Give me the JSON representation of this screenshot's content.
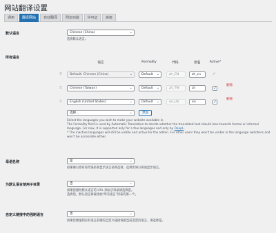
{
  "page": {
    "title": "网站翻译设置"
  },
  "tabs": [
    {
      "label": "通用",
      "active": false
    },
    {
      "label": "翻译网站",
      "active": true
    },
    {
      "label": "自动翻译",
      "active": false
    },
    {
      "label": "附加功能",
      "active": false
    },
    {
      "label": "许可证",
      "active": false
    },
    {
      "label": "高级",
      "active": false
    }
  ],
  "default_language": {
    "label": "默认语言",
    "value": "Chinese (China)",
    "description": "选择默认语言。"
  },
  "all_languages": {
    "label": "所有语言",
    "headers": {
      "language": "语言",
      "formality": "Formality",
      "code": "代码",
      "slug": "别名",
      "active": "Active*"
    },
    "rows": [
      {
        "language": "Default: Chinese (China)",
        "formality": "Default",
        "code": "zh_CN",
        "slug": "zh_cn",
        "active": true,
        "removable": false
      },
      {
        "language": "Chinese (Taiwan)",
        "formality": "Default",
        "code": "zh_TW",
        "slug": "zh",
        "active": true,
        "removable": true
      },
      {
        "language": "English (United States)",
        "formality": "Default",
        "code": "en_US",
        "slug": "en",
        "active": true,
        "removable": true
      }
    ],
    "remove_label": "删除",
    "add_select_placeholder": "选择...",
    "add_button": "添加",
    "description_1": "Select the languages you wish to make your website available in.",
    "description_2": "The Formality field is used by Automatic Translation to decide whether the translated text should lean towards formal or informal language. For now, it is supported only for a few languages and only by",
    "description_link": "DeepL",
    "description_3": "* The inactive languages will still be visible and active for the admin. For other users they won't be visible in the language switchers and won't be accessible either."
  },
  "native_names": {
    "label": "母语名称",
    "value": "是",
    "description": "如果要以原有的母语名称显示语言名称选择，选择否将以英语显示语言。"
  },
  "subdirectory": {
    "label": "为默认语言使用子目录",
    "value": "否",
    "description_1": "如果您想为默认语言的 URL 添加子目录请选择是。",
    "description_2": "选择后，默认语言将被添加\"所有语言\"列表的第一个。"
  },
  "force_language": {
    "label": "自定义链接中的强制语言",
    "value": "否",
    "description": "如果您想强制没有语言前缀的自定义链接保留当前选定的语言，请选择是。"
  },
  "icons": {
    "chevron": "chevron-down-icon",
    "handle": "drag-handle-icon",
    "check": "checkmark-icon"
  },
  "colors": {
    "accent": "#2271b1",
    "danger": "#d63638",
    "background": "#f0f0f1"
  }
}
